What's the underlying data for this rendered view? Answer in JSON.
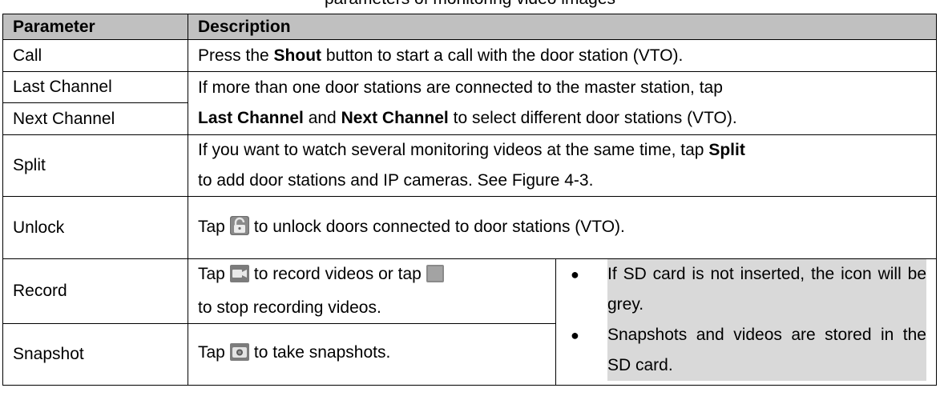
{
  "caption": "parameters of monitoring video images",
  "table": {
    "headers": {
      "parameter": "Parameter",
      "description": "Description"
    },
    "call": {
      "param": "Call",
      "pre": "Press the ",
      "bold": "Shout",
      "post": " button to start a call with the door station (VTO)."
    },
    "channels": {
      "last_param": "Last Channel",
      "next_param": "Next Channel",
      "line1": "If more than one door stations are connected to the master station, tap",
      "bold1": "Last Channel",
      "and": " and ",
      "bold2": "Next Channel",
      "post": " to select different door stations (VTO)."
    },
    "split": {
      "param": "Split",
      "pre": "If you want to watch several monitoring videos at the same time, tap ",
      "bold": "Split",
      "line2": "to add door stations and IP cameras. See Figure 4-3."
    },
    "unlock": {
      "param": "Unlock",
      "pre": "Tap",
      "post": "to unlock doors connected to door stations (VTO).",
      "icon": "unlock-icon"
    },
    "record": {
      "param": "Record",
      "pre": "Tap",
      "mid": "to record videos or tap",
      "line2": "to stop recording videos.",
      "icon_start": "record-icon",
      "icon_stop": "stop-icon"
    },
    "snapshot": {
      "param": "Snapshot",
      "pre": "Tap",
      "post": "to take snapshots.",
      "icon": "camera-icon"
    },
    "notes": [
      "If SD card is not inserted, the icon will be grey.",
      "Snapshots and videos are stored in the SD card."
    ]
  }
}
